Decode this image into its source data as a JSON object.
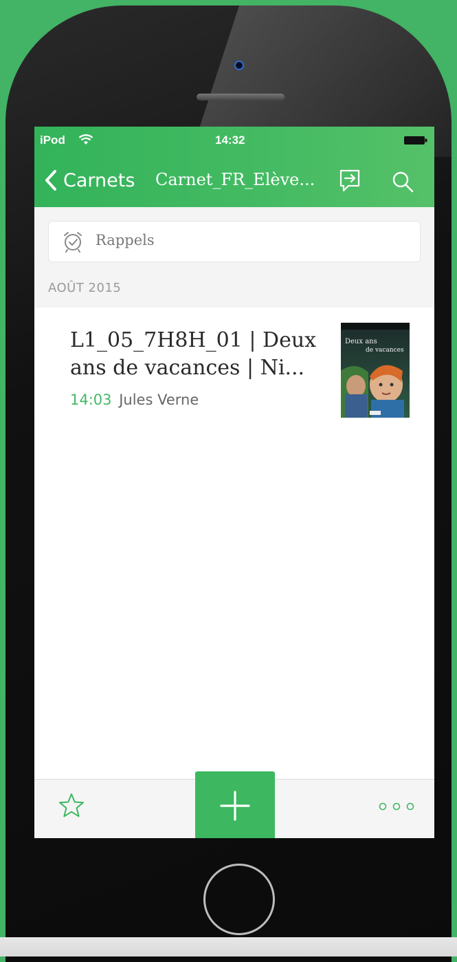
{
  "status_bar": {
    "carrier": "iPod",
    "time": "14:32"
  },
  "nav": {
    "back_label": "Carnets",
    "title": "Carnet_FR_Elève..."
  },
  "reminders": {
    "label": "Rappels"
  },
  "section": {
    "header": "AOÛT 2015"
  },
  "notes": [
    {
      "title": "L1_05_7H8H_01 | Deux ans de vacances | Ni...",
      "time": "14:03",
      "author": "Jules Verne",
      "thumbnail": {
        "title": "Deux ans de vacances"
      }
    }
  ],
  "colors": {
    "accent": "#3db860",
    "header_green": "#45bb63",
    "time_green": "#44b866"
  },
  "icons": {
    "back": "chevron-left-icon",
    "share": "share-icon",
    "search": "search-icon",
    "reminder": "alarm-clock-icon",
    "favorite": "star-icon",
    "add": "plus-icon",
    "more": "more-icon"
  }
}
